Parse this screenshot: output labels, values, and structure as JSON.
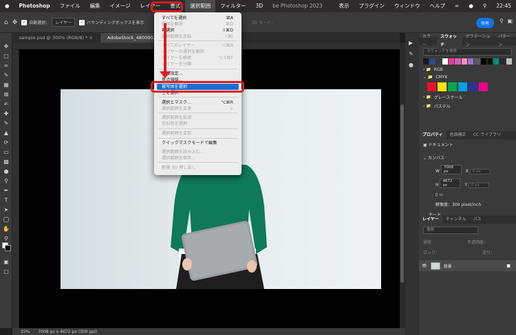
{
  "menubar": {
    "apple": "",
    "app_name": "Photoshop",
    "items": [
      "ファイル",
      "編集",
      "イメージ",
      "レイヤー",
      "書式",
      "選択範囲",
      "フィルター",
      "3D"
    ],
    "right_items": [
      "表示",
      "プラグイン",
      "ウィンドウ",
      "ヘルプ"
    ],
    "clock": "22:45",
    "window_title": "be Photoshop 2023"
  },
  "options": {
    "auto_select_label": "自動選択：",
    "auto_select_value": "レイヤー",
    "bbox_label": "バウンディングボックスを表示",
    "mode_3d": "3D モード：",
    "share": "共有"
  },
  "tabs": [
    "sample.psd @ 300% (RGB/8) *",
    "AdobeStock_480090237.jpeg"
  ],
  "select_menu": {
    "items": [
      {
        "label": "すべてを選択",
        "shortcut": "⌘A",
        "disabled": false
      },
      {
        "label": "選択を解除",
        "shortcut": "⌘D",
        "disabled": true
      },
      {
        "label": "再選択",
        "shortcut": "⇧⌘D",
        "disabled": false
      },
      {
        "label": "選択範囲を反転",
        "shortcut": "⇧⌘I",
        "disabled": true
      },
      {
        "label": "すべてのレイヤー",
        "shortcut": "⌥⌘A",
        "disabled": true
      },
      {
        "label": "レイヤーの選択を解除",
        "shortcut": "",
        "disabled": true
      },
      {
        "label": "レイヤーを検索",
        "shortcut": "⌥⇧⌘F",
        "disabled": true
      },
      {
        "label": "レイヤーを分離",
        "shortcut": "",
        "disabled": true
      },
      {
        "label": "色域指定...",
        "shortcut": "",
        "disabled": false
      },
      {
        "label": "焦点領域...",
        "shortcut": "",
        "disabled": false
      },
      {
        "label": "被写体を選択",
        "shortcut": "",
        "disabled": false,
        "highlighted": true
      },
      {
        "label": "空を選択",
        "shortcut": "",
        "disabled": false
      },
      {
        "label": "選択とマスク...",
        "shortcut": "⌥⌘R",
        "disabled": false
      },
      {
        "label": "選択範囲を変更",
        "shortcut": ">",
        "disabled": true
      },
      {
        "label": "選択範囲を拡張",
        "shortcut": "",
        "disabled": true
      },
      {
        "label": "近似色を選択",
        "shortcut": "",
        "disabled": true
      },
      {
        "label": "選択範囲を変形",
        "shortcut": "",
        "disabled": true
      },
      {
        "label": "クイックマスクモードで編集",
        "shortcut": "",
        "disabled": false
      },
      {
        "label": "選択範囲を読み込む...",
        "shortcut": "",
        "disabled": true
      },
      {
        "label": "選択範囲を保存...",
        "shortcut": "",
        "disabled": true
      },
      {
        "label": "新規 3D 押し出し",
        "shortcut": "",
        "disabled": true
      }
    ]
  },
  "swatch_panel": {
    "tabs": [
      "カラー",
      "スウォッチ",
      "グラデーション",
      "パターン"
    ],
    "active_tab": "スウォッチ",
    "search_placeholder": "スウォッチを検索",
    "recent_colors": [
      "#1a1a1a",
      "#2a4a8a",
      "#3a3a3a",
      "#ffffff",
      "#e0409a",
      "#d060c0",
      "#f090c0",
      "#a070d0",
      "#5a5a5a",
      "#000000",
      "#111111",
      "#009070",
      "#2a2a2a",
      "#c0c0c0"
    ],
    "folders": [
      "RGB",
      "CMYK",
      "グレースケール",
      "パステル"
    ],
    "cmyk_colors": [
      "#e8102a",
      "#ffe500",
      "#00a650",
      "#00a0e0",
      "#2e3192",
      "#ec008c"
    ]
  },
  "properties_panel": {
    "tabs": [
      "プロパティ",
      "色調補正",
      "CC ライブラリ"
    ],
    "doc_label": "ドキュメント",
    "canvas_label": "カンバス",
    "w_label": "W",
    "w_value": "7008 px",
    "h_label": "H",
    "h_value": "4672 px",
    "x_label": "X",
    "x_value": "0 px",
    "y_label": "Y",
    "y_value": "0 px",
    "resolution": "解像度：300 pixel/inch",
    "mode_label": "モード"
  },
  "layers_panel": {
    "tabs": [
      "レイヤー",
      "チャンネル",
      "パス"
    ],
    "kind_label": "種類",
    "blend_mode": "通常",
    "opacity_label": "不透明度：",
    "lock_label": "ロック：",
    "fill_label": "塗り：",
    "layer_name": "背景"
  },
  "statusbar": {
    "zoom": "25%",
    "doc_info": "7008 px x 4672 px (300 ppi)"
  }
}
